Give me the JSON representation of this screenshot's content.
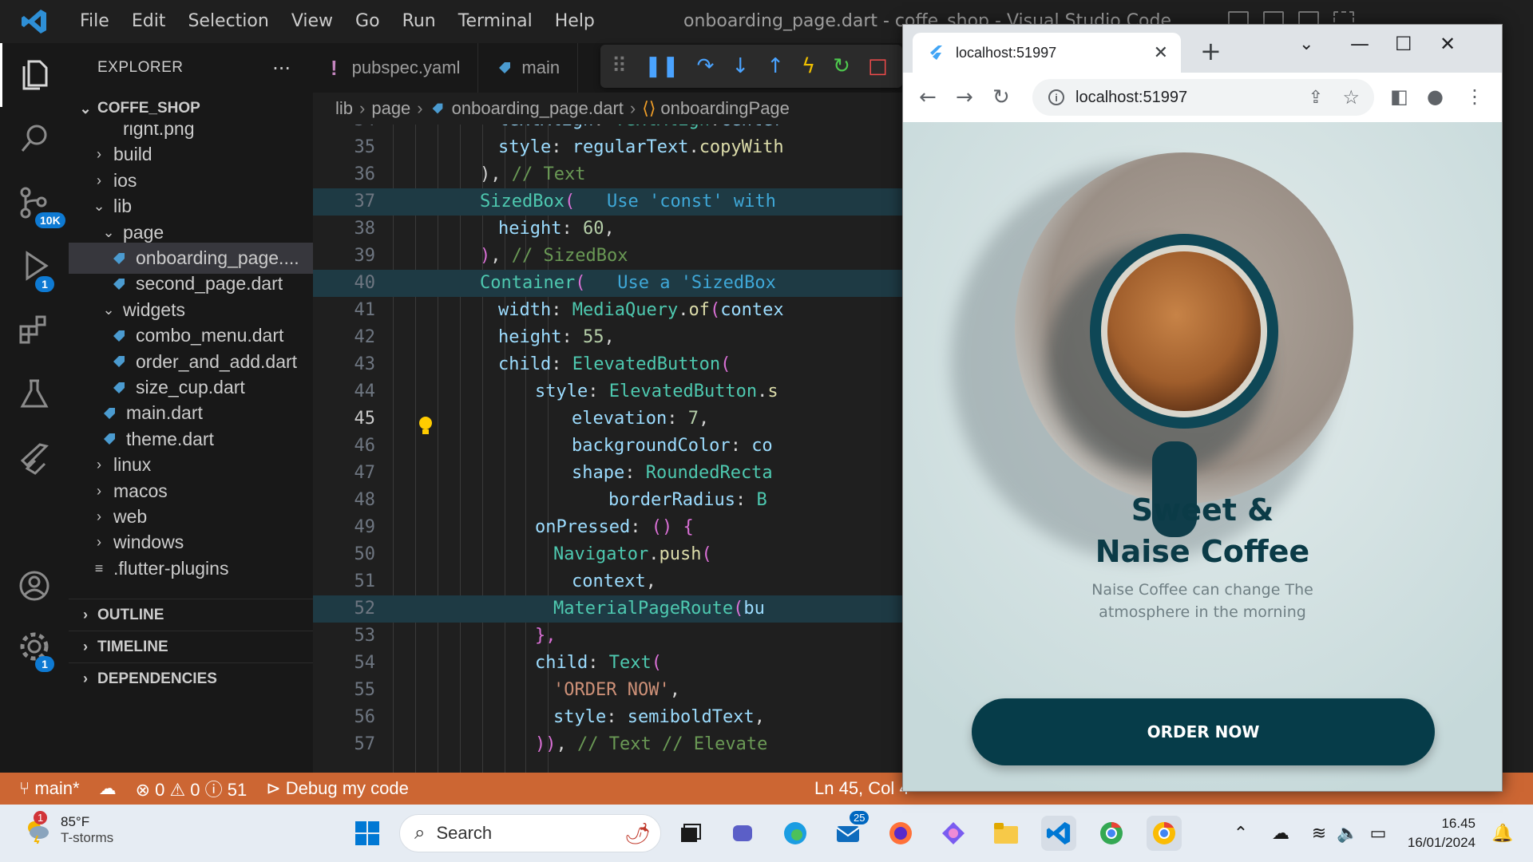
{
  "titlebar": {
    "menu": [
      "File",
      "Edit",
      "Selection",
      "View",
      "Go",
      "Run",
      "Terminal",
      "Help"
    ],
    "window_title": "onboarding_page.dart - coffe_shop - Visual Studio Code"
  },
  "activity_bar": {
    "source_control_badge": "10K",
    "debug_badge": "1",
    "settings_badge": "1"
  },
  "explorer": {
    "header": "EXPLORER",
    "more": "···",
    "project": "COFFE_SHOP",
    "items": [
      {
        "label": "right.png",
        "depth": 2,
        "type": "file"
      },
      {
        "label": "build",
        "depth": 1,
        "type": "folder-closed"
      },
      {
        "label": "ios",
        "depth": 1,
        "type": "folder-closed"
      },
      {
        "label": "lib",
        "depth": 1,
        "type": "folder-open"
      },
      {
        "label": "page",
        "depth": 2,
        "type": "folder-open"
      },
      {
        "label": "onboarding_page....",
        "depth": 3,
        "type": "dart",
        "selected": true
      },
      {
        "label": "second_page.dart",
        "depth": 3,
        "type": "dart"
      },
      {
        "label": "widgets",
        "depth": 2,
        "type": "folder-open"
      },
      {
        "label": "combo_menu.dart",
        "depth": 3,
        "type": "dart"
      },
      {
        "label": "order_and_add.dart",
        "depth": 3,
        "type": "dart"
      },
      {
        "label": "size_cup.dart",
        "depth": 3,
        "type": "dart"
      },
      {
        "label": "main.dart",
        "depth": 2,
        "type": "dart"
      },
      {
        "label": "theme.dart",
        "depth": 2,
        "type": "dart"
      },
      {
        "label": "linux",
        "depth": 1,
        "type": "folder-closed"
      },
      {
        "label": "macos",
        "depth": 1,
        "type": "folder-closed"
      },
      {
        "label": "web",
        "depth": 1,
        "type": "folder-closed"
      },
      {
        "label": "windows",
        "depth": 1,
        "type": "folder-closed"
      },
      {
        "label": ".flutter-plugins",
        "depth": 1,
        "type": "text"
      }
    ],
    "sections": [
      "OUTLINE",
      "TIMELINE",
      "DEPENDENCIES"
    ]
  },
  "editor": {
    "tabs": [
      "pubspec.yaml",
      "main"
    ],
    "breadcrumb": [
      "lib",
      "page",
      "onboarding_page.dart",
      "onboardingPage"
    ],
    "lines": [
      {
        "n": "34",
        "indent": 9,
        "parts": [
          [
            "p",
            "textAlign"
          ],
          [
            "w",
            ": "
          ],
          [
            "k",
            "TextAlign"
          ],
          [
            "w",
            "."
          ],
          [
            "p",
            "center"
          ]
        ]
      },
      {
        "n": "35",
        "indent": 9,
        "parts": [
          [
            "p",
            "style"
          ],
          [
            "w",
            ": "
          ],
          [
            "p",
            "regularText"
          ],
          [
            "w",
            "."
          ],
          [
            "f",
            "copyWith"
          ]
        ]
      },
      {
        "n": "36",
        "indent": 8,
        "parts": [
          [
            "w",
            "), "
          ],
          [
            "c",
            "// Text"
          ]
        ]
      },
      {
        "n": "37",
        "indent": 8,
        "hl": true,
        "parts": [
          [
            "k",
            "SizedBox"
          ],
          [
            "b",
            "("
          ],
          [
            "w",
            "   "
          ],
          [
            "hint",
            "Use 'const' with"
          ]
        ]
      },
      {
        "n": "38",
        "indent": 9,
        "parts": [
          [
            "p",
            "height"
          ],
          [
            "w",
            ": "
          ],
          [
            "n",
            "60"
          ],
          [
            "w",
            ","
          ]
        ]
      },
      {
        "n": "39",
        "indent": 8,
        "parts": [
          [
            "b",
            ")"
          ],
          [
            "w",
            ", "
          ],
          [
            "c",
            "// SizedBox"
          ]
        ]
      },
      {
        "n": "40",
        "indent": 8,
        "hl": true,
        "parts": [
          [
            "k",
            "Container"
          ],
          [
            "b",
            "("
          ],
          [
            "w",
            "   "
          ],
          [
            "hint",
            "Use a 'SizedBox"
          ]
        ]
      },
      {
        "n": "41",
        "indent": 9,
        "parts": [
          [
            "p",
            "width"
          ],
          [
            "w",
            ": "
          ],
          [
            "k",
            "MediaQuery"
          ],
          [
            "w",
            "."
          ],
          [
            "f",
            "of"
          ],
          [
            "b",
            "("
          ],
          [
            "p",
            "contex"
          ]
        ]
      },
      {
        "n": "42",
        "indent": 9,
        "parts": [
          [
            "p",
            "height"
          ],
          [
            "w",
            ": "
          ],
          [
            "n",
            "55"
          ],
          [
            "w",
            ","
          ]
        ]
      },
      {
        "n": "43",
        "indent": 9,
        "parts": [
          [
            "p",
            "child"
          ],
          [
            "w",
            ": "
          ],
          [
            "k",
            "ElevatedButton"
          ],
          [
            "b",
            "("
          ]
        ]
      },
      {
        "n": "44",
        "indent": 11,
        "parts": [
          [
            "p",
            "style"
          ],
          [
            "w",
            ": "
          ],
          [
            "k",
            "ElevatedButton"
          ],
          [
            "w",
            "."
          ],
          [
            "f",
            "s"
          ]
        ]
      },
      {
        "n": "45",
        "indent": 13,
        "cur": true,
        "parts": [
          [
            "p",
            "elevation"
          ],
          [
            "w",
            ": "
          ],
          [
            "n",
            "7"
          ],
          [
            "w",
            ","
          ]
        ]
      },
      {
        "n": "46",
        "indent": 13,
        "parts": [
          [
            "p",
            "backgroundColor"
          ],
          [
            "w",
            ": "
          ],
          [
            "p",
            "co"
          ]
        ]
      },
      {
        "n": "47",
        "indent": 13,
        "parts": [
          [
            "p",
            "shape"
          ],
          [
            "w",
            ": "
          ],
          [
            "k",
            "RoundedRecta"
          ]
        ]
      },
      {
        "n": "48",
        "indent": 15,
        "parts": [
          [
            "p",
            "borderRadius"
          ],
          [
            "w",
            ": "
          ],
          [
            "k",
            "B"
          ]
        ]
      },
      {
        "n": "49",
        "indent": 11,
        "parts": [
          [
            "p",
            "onPressed"
          ],
          [
            "w",
            ": "
          ],
          [
            "b",
            "() {"
          ]
        ]
      },
      {
        "n": "50",
        "indent": 12,
        "parts": [
          [
            "k",
            "Navigator"
          ],
          [
            "w",
            "."
          ],
          [
            "f",
            "push"
          ],
          [
            "b",
            "("
          ]
        ]
      },
      {
        "n": "51",
        "indent": 13,
        "parts": [
          [
            "p",
            "context"
          ],
          [
            "w",
            ","
          ]
        ]
      },
      {
        "n": "52",
        "indent": 12,
        "hl": true,
        "parts": [
          [
            "k",
            "MaterialPageRoute"
          ],
          [
            "b",
            "("
          ],
          [
            "p",
            "bu"
          ]
        ]
      },
      {
        "n": "53",
        "indent": 11,
        "parts": [
          [
            "b",
            "},"
          ]
        ]
      },
      {
        "n": "54",
        "indent": 11,
        "parts": [
          [
            "p",
            "child"
          ],
          [
            "w",
            ": "
          ],
          [
            "k",
            "Text"
          ],
          [
            "b",
            "("
          ]
        ]
      },
      {
        "n": "55",
        "indent": 12,
        "parts": [
          [
            "s",
            "'ORDER NOW'"
          ],
          [
            "w",
            ","
          ]
        ]
      },
      {
        "n": "56",
        "indent": 12,
        "parts": [
          [
            "p",
            "style"
          ],
          [
            "w",
            ": "
          ],
          [
            "p",
            "semiboldText"
          ],
          [
            "w",
            ","
          ]
        ]
      },
      {
        "n": "57",
        "indent": 11,
        "parts": [
          [
            "b",
            "))"
          ],
          [
            "w",
            ", "
          ],
          [
            "c",
            "// Text // Elevate"
          ]
        ]
      }
    ]
  },
  "statusbar": {
    "branch": "main*",
    "problems": "⊗ 0 ⚠ 0 ⓘ 51",
    "debug": "Debug my code",
    "position": "Ln 45, Col 4"
  },
  "browser": {
    "tab_title": "localhost:51997",
    "url": "localhost:51997"
  },
  "app": {
    "title_line1": "Sweet &",
    "title_line2": "Naise Coffee",
    "subtitle_line1": "Naise Coffee can change The",
    "subtitle_line2": "atmosphere in the morning",
    "button": "ORDER NOW"
  },
  "taskbar": {
    "weather_badge": "1",
    "temperature": "85°F",
    "condition": "T-storms",
    "search": "Search",
    "mail_badge": "25",
    "time": "16.45",
    "date": "16/01/2024"
  },
  "colors": {
    "accent_status": "#cc6633",
    "app_button": "#063c49",
    "app_title": "#0b3b47"
  }
}
